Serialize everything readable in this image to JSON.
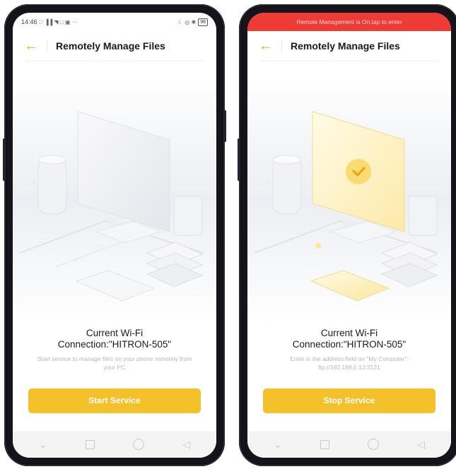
{
  "phones": [
    {
      "statusbar": {
        "time": "14:46",
        "left_icons": "∷ ▐▐ ◥ □ ▣ ···",
        "right_icons": "☾ ◎ ✱",
        "battery": "98"
      },
      "appbar": {
        "back_icon": "arrow-left-icon",
        "title": "Remotely Manage Files"
      },
      "heading_line1": "Current Wi-Fi",
      "heading_line2": "Connection:\"HITRON-505\"",
      "subtext_line1": "Start service to manage files on your phone remotely from",
      "subtext_line2": "your PC",
      "button_label": "Start Service"
    },
    {
      "banner": "Remote Management is On,tap to enter",
      "appbar": {
        "back_icon": "arrow-left-icon",
        "title": "Remotely Manage Files"
      },
      "heading_line1": "Current Wi-Fi",
      "heading_line2": "Connection:\"HITRON-505\"",
      "subtext_line1": "Enter in the address field on \"My Computer\":",
      "subtext_line2": "ftp://192.168.0.12:2121",
      "button_label": "Stop Service"
    }
  ],
  "colors": {
    "accent": "#f5c12a",
    "back_arrow": "#f3ad1c",
    "banner": "#ee3b35"
  }
}
